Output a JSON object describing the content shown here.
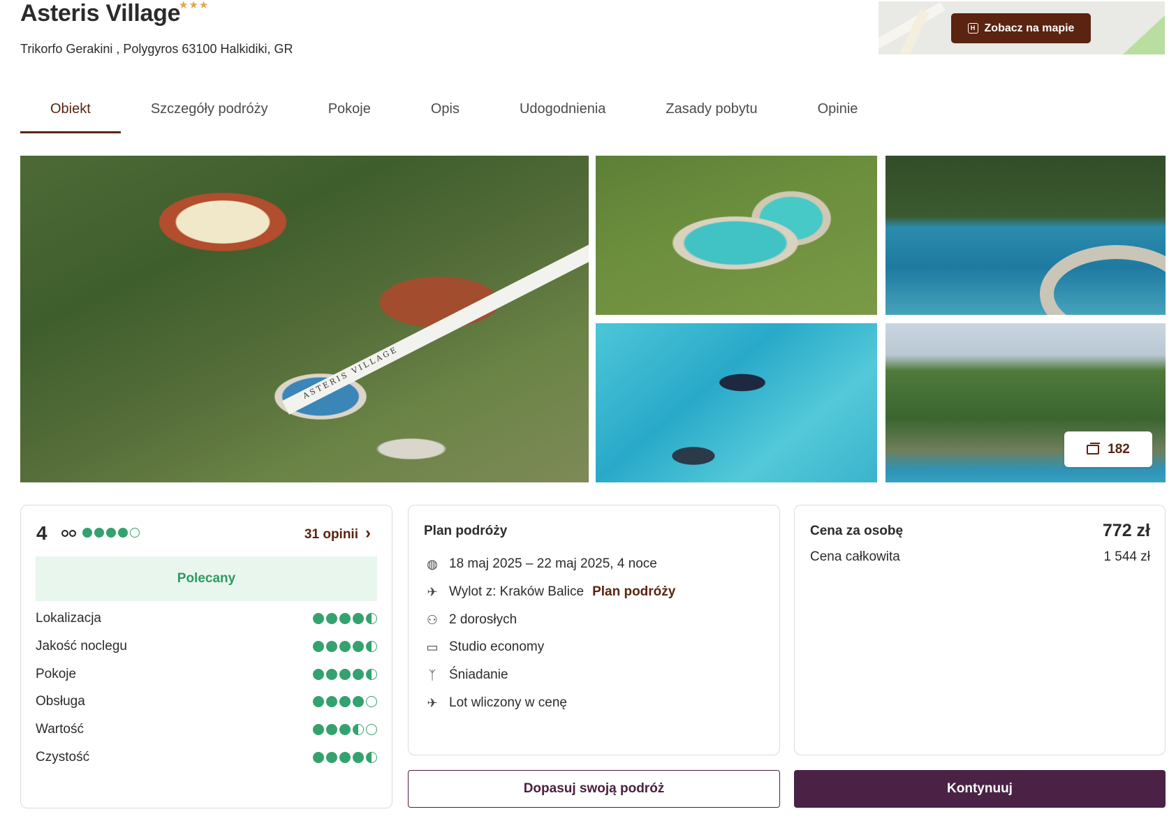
{
  "hotel": {
    "name": "Asteris Village",
    "stars": "★★★",
    "address": "Trikorfo Gerakini , Polygyros 63100 Halkidiki, GR"
  },
  "map": {
    "button_label": "Zobacz na mapie"
  },
  "tabs": [
    {
      "label": "Obiekt",
      "active": true
    },
    {
      "label": "Szczegóły podróży"
    },
    {
      "label": "Pokoje"
    },
    {
      "label": "Opis"
    },
    {
      "label": "Udogodnienia"
    },
    {
      "label": "Zasady pobytu"
    },
    {
      "label": "Opinie"
    }
  ],
  "gallery": {
    "photo_count": "182",
    "watermark_text": "ASTERIS VILLAGE"
  },
  "rating": {
    "score": "4",
    "score_dots": 4,
    "reviews_link": "31 opinii",
    "badge": "Polecany",
    "criteria": [
      {
        "label": "Lokalizacja",
        "value": 4.5
      },
      {
        "label": "Jakość noclegu",
        "value": 4.5
      },
      {
        "label": "Pokoje",
        "value": 4.5
      },
      {
        "label": "Obsługa",
        "value": 4
      },
      {
        "label": "Wartość",
        "value": 3.5
      },
      {
        "label": "Czystość",
        "value": 4.5
      }
    ]
  },
  "plan": {
    "title": "Plan podróży",
    "dates": "18 maj 2025 – 22 maj 2025, 4 noce",
    "departure": "Wylot z: Kraków Balice",
    "departure_link": "Plan podróży",
    "guests": "2 dorosłych",
    "room": "Studio economy",
    "board": "Śniadanie",
    "flight": "Lot wliczony w cenę"
  },
  "price": {
    "per_person_label": "Cena za osobę",
    "per_person_value": "772 zł",
    "total_label": "Cena całkowita",
    "total_value": "1 544 zł"
  },
  "actions": {
    "adjust": "Dopasuj swoją podróż",
    "continue": "Kontynuuj"
  },
  "colors": {
    "brand_brown": "#5a2410",
    "cta_plum": "#4a2245",
    "rating_green": "#34a26e",
    "stars_orange": "#e8a24a"
  }
}
